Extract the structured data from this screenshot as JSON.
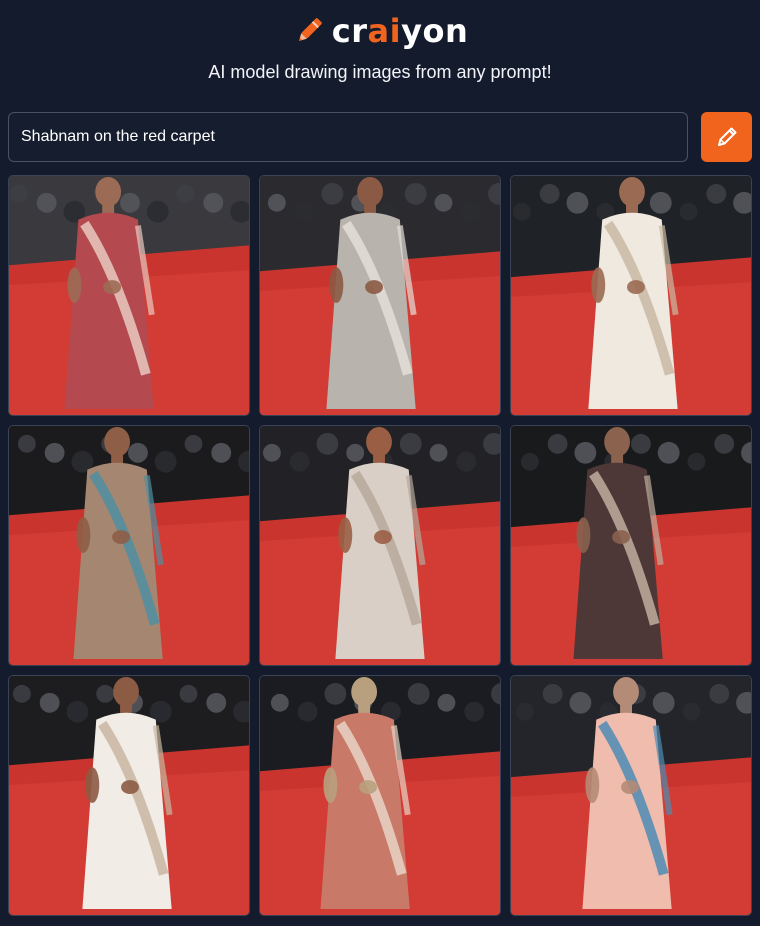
{
  "app": {
    "logo_prefix": "cr",
    "logo_accent": "ai",
    "logo_suffix": "yon",
    "tagline": "AI model drawing images from any prompt!",
    "accent_color": "#f1641e",
    "background_color": "#141b2d"
  },
  "search": {
    "value": "Shabnam on the red carpet",
    "button_icon": "pencil-icon"
  },
  "results": [
    {
      "name": "result-image-1",
      "dress": "#b44a4f",
      "trim": "#e8c9c0",
      "skin": "#9c6b55",
      "bg": "#3a3a3e"
    },
    {
      "name": "result-image-2",
      "dress": "#b9b3ad",
      "trim": "#e4ded8",
      "skin": "#8b5a44",
      "bg": "#2b2b2f"
    },
    {
      "name": "result-image-3",
      "dress": "#efe9e0",
      "trim": "#c9b9a3",
      "skin": "#9a6a52",
      "bg": "#1f2226"
    },
    {
      "name": "result-image-4",
      "dress": "#a58670",
      "trim": "#4e8ea2",
      "skin": "#8f5e47",
      "bg": "#1b1b1d"
    },
    {
      "name": "result-image-5",
      "dress": "#d9cfc6",
      "trim": "#b7a89b",
      "skin": "#9a5e45",
      "bg": "#222226"
    },
    {
      "name": "result-image-6",
      "dress": "#4e3737",
      "trim": "#bfae9d",
      "skin": "#8a624e",
      "bg": "#181a1c"
    },
    {
      "name": "result-image-7",
      "dress": "#f1ece6",
      "trim": "#c8b6a0",
      "skin": "#8c5b44",
      "bg": "#1d1d20"
    },
    {
      "name": "result-image-8",
      "dress": "#c97967",
      "trim": "#e7d4c6",
      "skin": "#b8a07e",
      "bg": "#1a1c21"
    },
    {
      "name": "result-image-9",
      "dress": "#efbcae",
      "trim": "#4d8cb4",
      "skin": "#b48b76",
      "bg": "#23252a"
    }
  ]
}
